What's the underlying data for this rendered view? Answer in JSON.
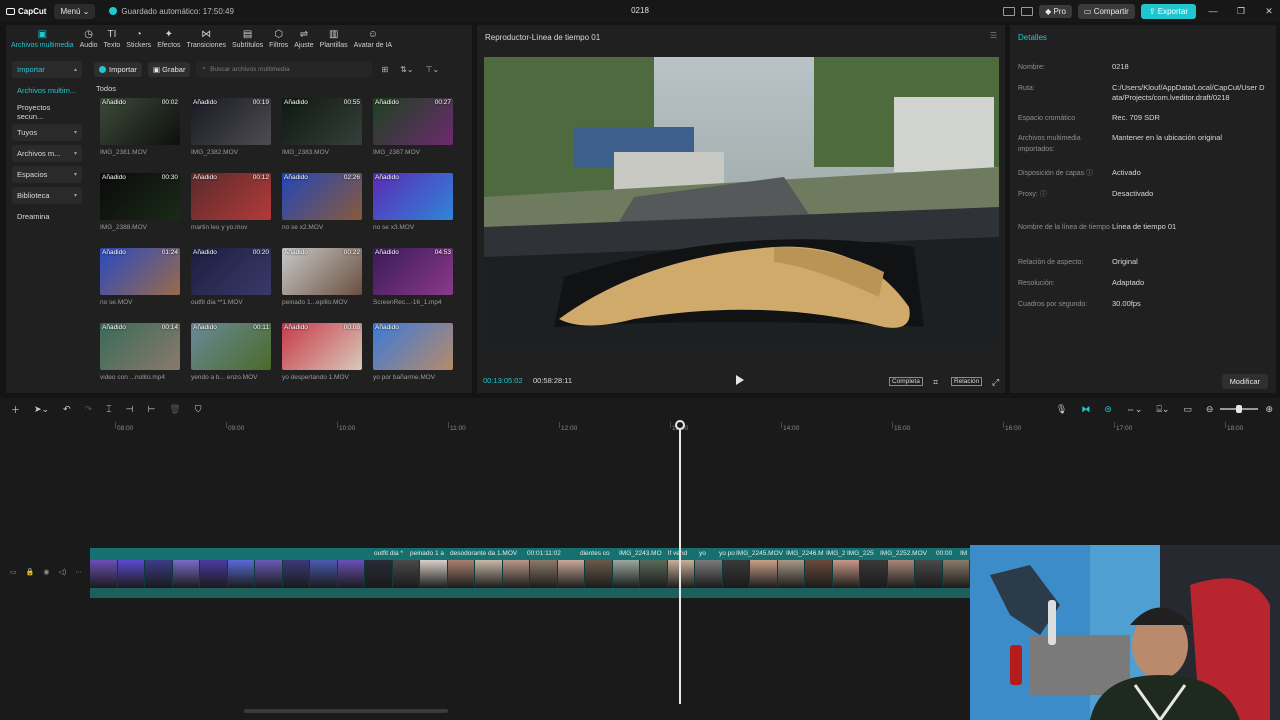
{
  "titlebar": {
    "logo": "CapCut",
    "menu": "Menú",
    "autosave": "Guardado automático: 17:50:49",
    "title": "0218",
    "pro": "Pro",
    "share": "Compartir",
    "export": "Exportar"
  },
  "tool_tabs": [
    {
      "label": "Archivos multimedia",
      "icon": "media-icon",
      "glyph": "▣"
    },
    {
      "label": "Audio",
      "icon": "audio-icon",
      "glyph": "◷"
    },
    {
      "label": "Texto",
      "icon": "text-icon",
      "glyph": "TI"
    },
    {
      "label": "Stickers",
      "icon": "sticker-icon",
      "glyph": "◔"
    },
    {
      "label": "Efectos",
      "icon": "effects-icon",
      "glyph": "✦"
    },
    {
      "label": "Transiciones",
      "icon": "transitions-icon",
      "glyph": "⋈"
    },
    {
      "label": "Subtítulos",
      "icon": "subtitles-icon",
      "glyph": "▤"
    },
    {
      "label": "Filtros",
      "icon": "filters-icon",
      "glyph": "⬡"
    },
    {
      "label": "Ajuste",
      "icon": "adjust-icon",
      "glyph": "⇌"
    },
    {
      "label": "Plantillas",
      "icon": "templates-icon",
      "glyph": "▥"
    },
    {
      "label": "Avatar de IA",
      "icon": "ai-avatar-icon",
      "glyph": "☺"
    }
  ],
  "sidebar": [
    {
      "label": "Importar",
      "chev": "▴"
    },
    {
      "label": "Archivos multim..."
    },
    {
      "label": "Proyectos secun..."
    },
    {
      "label": "Tuyos",
      "chev": "▾"
    },
    {
      "label": "Archivos m...",
      "chev": "▾"
    },
    {
      "label": "Espacios",
      "chev": "▾"
    },
    {
      "label": "Biblioteca",
      "chev": "▾"
    },
    {
      "label": "Dreamina"
    }
  ],
  "media": {
    "import": "Importar",
    "record": "Grabar",
    "search_placeholder": "Buscar archivos multimedia",
    "section": "Todos",
    "clips": [
      {
        "name": "IMG_2381.MOV",
        "duration": "00:02",
        "badge": "Añadido",
        "c1": "#3d4a3a",
        "c2": "#0d100c"
      },
      {
        "name": "IMG_2382.MOV",
        "duration": "00:19",
        "badge": "Añadido",
        "c1": "#1a1a22",
        "c2": "#4c4c52"
      },
      {
        "name": "IMG_2383.MOV",
        "duration": "00:55",
        "badge": "Añadido",
        "c1": "#0f1912",
        "c2": "#36403a"
      },
      {
        "name": "IMG_2387.MOV",
        "duration": "00:27",
        "badge": "Añadido",
        "c1": "#1c4220",
        "c2": "#6d2a6e"
      },
      {
        "name": "IMG_2388.MOV",
        "duration": "00:30",
        "badge": "Añadido",
        "c1": "#0a0a0a",
        "c2": "#1a2a18"
      },
      {
        "name": "martin leo y yo.mov",
        "duration": "00:12",
        "badge": "Añadido",
        "c1": "#5a2a2a",
        "c2": "#b33a3a"
      },
      {
        "name": "no se x2.MOV",
        "duration": "02:26",
        "badge": "Añadido",
        "c1": "#2246b8",
        "c2": "#8a5a3a"
      },
      {
        "name": "no se x3.MOV",
        "duration": "",
        "badge": "Añadido",
        "c1": "#5b2ab5",
        "c2": "#2f86d8"
      },
      {
        "name": "no se.MOV",
        "duration": "01:24",
        "badge": "Añadido",
        "c1": "#2a4ac0",
        "c2": "#9a6a4a"
      },
      {
        "name": "outfit dia **1.MOV",
        "duration": "00:20",
        "badge": "Añadido",
        "c1": "#1d1d40",
        "c2": "#3a3a6a"
      },
      {
        "name": "peinado 1...epillo.MOV",
        "duration": "00:22",
        "badge": "Añadido",
        "c1": "#c8c8c8",
        "c2": "#6a5040"
      },
      {
        "name": "ScreenRec...-16_1.mp4",
        "duration": "04:53",
        "badge": "Añadido",
        "c1": "#3a1a5a",
        "c2": "#8a3a8a"
      },
      {
        "name": "video con ...nolito.mp4",
        "duration": "00:14",
        "badge": "Añadido",
        "c1": "#3a6a5a",
        "c2": "#8a7a6a"
      },
      {
        "name": "yendo a b... enzo.MOV",
        "duration": "00:11",
        "badge": "Añadido",
        "c1": "#6a8a9a",
        "c2": "#4a6a2a"
      },
      {
        "name": "yo despertando 1.MOV",
        "duration": "00:08",
        "badge": "Añadido",
        "c1": "#c83a4a",
        "c2": "#d8c8b8"
      },
      {
        "name": "yo por bañarme.MOV",
        "duration": "",
        "badge": "Añadido",
        "c1": "#3a7ad8",
        "c2": "#b88a6a"
      }
    ]
  },
  "player": {
    "title": "Reproductor-Línea de tiempo 01",
    "current": "00:13:05:02",
    "total": "00:58:28:11",
    "full": "Completa",
    "ratio": "Relación"
  },
  "details": {
    "title": "Detalles",
    "rows": [
      {
        "label": "Nombre:",
        "value": "0218"
      },
      {
        "label": "Ruta:",
        "value": "C:/Users/Klouf/AppData/Local/CapCut/User Data/Projects/com.lveditor.draft/0218"
      },
      {
        "label": "Espacio cromático",
        "value": "Rec. 709 SDR"
      },
      {
        "label": "Archivos multimedia importados:",
        "value": "Mantener en la ubicación original"
      },
      {
        "label": "Disposición de capas ⓘ",
        "value": "Activado"
      },
      {
        "label": "Proxy: ⓘ",
        "value": "Desactivado"
      },
      {
        "label": "Nombre de la línea de tiempo",
        "value": "Línea de tiempo 01"
      },
      {
        "label": "Relación de aspecto:",
        "value": "Original"
      },
      {
        "label": "Resolución:",
        "value": "Adaptado"
      },
      {
        "label": "Cuadros por segundo:",
        "value": "30.00fps"
      }
    ],
    "modify": "Modificar"
  },
  "timeline": {
    "ruler": [
      "08:00",
      "09:00",
      "10:00",
      "11:00",
      "12:00",
      "13:00",
      "14:00",
      "15:00",
      "16:00",
      "17:00",
      "18:00"
    ],
    "clip_labels": [
      "outfit dia *",
      "peinado 1 a",
      "desodorante da 1.MOV",
      "00:01:11:02",
      "dientes co",
      "IMG_2243.MO",
      "lf vend",
      "yo",
      "yo po",
      "IMG_2245.MOV",
      "IMG_2246.M",
      "IMG_2",
      "IMG_225",
      "IMG_2252.MOV",
      "00:00",
      "IM"
    ]
  }
}
